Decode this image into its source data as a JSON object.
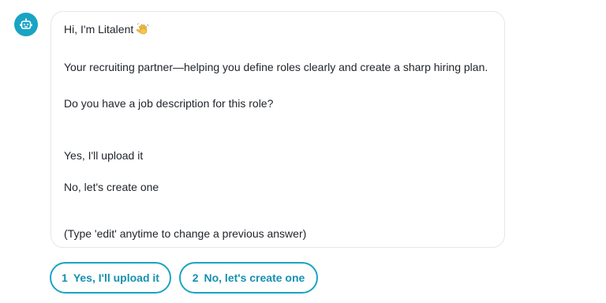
{
  "assistant": {
    "avatar_icon": "robot-icon",
    "avatar_color": "#1aa3c4"
  },
  "message": {
    "greeting": "Hi, I'm Litalent",
    "greeting_emoji": "waving-hand-emoji",
    "intro": "Your recruiting partner—helping you define roles clearly and create a sharp hiring plan.",
    "question": "Do you have a job description for this role?",
    "option_1": "Yes, I'll upload it",
    "option_2": "No, let's create one",
    "hint": "(Type 'edit' anytime to change a previous answer)"
  },
  "choices": [
    {
      "number": "1",
      "label": "Yes, I'll upload it"
    },
    {
      "number": "2",
      "label": "No, let's create one"
    }
  ],
  "accent_color": "#1aa3c4"
}
